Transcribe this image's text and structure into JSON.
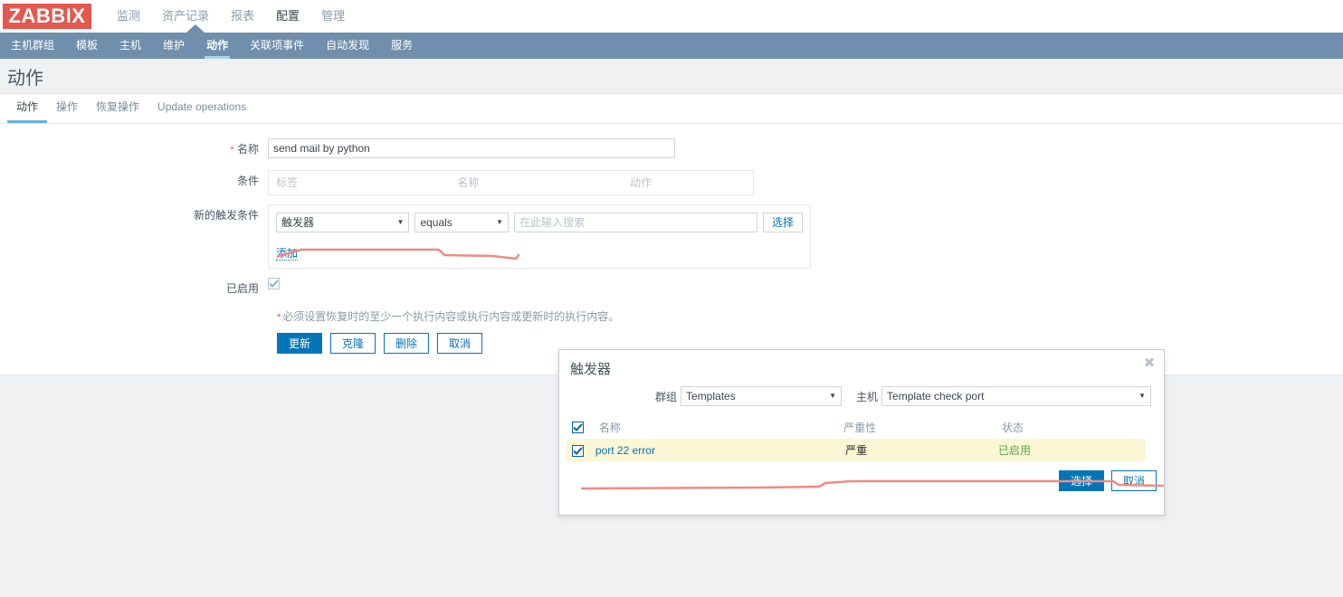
{
  "header": {
    "logo_text": "ZABBIX",
    "menu": [
      {
        "label": "监测",
        "selected": false
      },
      {
        "label": "资产记录",
        "selected": false
      },
      {
        "label": "报表",
        "selected": false
      },
      {
        "label": "配置",
        "selected": true
      },
      {
        "label": "管理",
        "selected": false
      }
    ]
  },
  "subnav": {
    "items": [
      {
        "label": "主机群组",
        "selected": false
      },
      {
        "label": "模板",
        "selected": false
      },
      {
        "label": "主机",
        "selected": false
      },
      {
        "label": "维护",
        "selected": false
      },
      {
        "label": "动作",
        "selected": true
      },
      {
        "label": "关联项事件",
        "selected": false
      },
      {
        "label": "自动发现",
        "selected": false
      },
      {
        "label": "服务",
        "selected": false
      }
    ]
  },
  "page": {
    "title": "动作"
  },
  "tabs": [
    {
      "label": "动作",
      "selected": true
    },
    {
      "label": "操作",
      "selected": false
    },
    {
      "label": "恢复操作",
      "selected": false
    },
    {
      "label": "Update operations",
      "selected": false
    }
  ],
  "form": {
    "name_label": "名称",
    "name_value": "send mail by python",
    "conditions_label": "条件",
    "conditions_headers": [
      "标签",
      "名称",
      "动作"
    ],
    "new_condition_label": "新的触发条件",
    "new_condition": {
      "type_value": "触发器",
      "operator_value": "equals",
      "search_placeholder": "在此输入搜索",
      "search_value": "",
      "select_button": "选择",
      "add_link": "添加"
    },
    "enabled_label": "已启用",
    "enabled_checked": true,
    "footnote": "必须设置恢复时的至少一个执行内容或执行内容或更新时的执行内容。",
    "buttons": [
      {
        "label": "更新",
        "primary": true
      },
      {
        "label": "克隆",
        "primary": false
      },
      {
        "label": "删除",
        "primary": false
      },
      {
        "label": "取消",
        "primary": false
      }
    ]
  },
  "modal": {
    "title": "触发器",
    "close_icon": "✖",
    "group_label": "群组",
    "group_value": "Templates",
    "host_label": "主机",
    "host_value": "Template check port",
    "table": {
      "headers": [
        "名称",
        "严重性",
        "状态"
      ],
      "header_checkbox_checked": true,
      "rows": [
        {
          "checked": true,
          "name": "port 22 error",
          "severity": "严重",
          "status": "已启用"
        }
      ]
    },
    "buttons": [
      {
        "label": "选择",
        "primary": true
      },
      {
        "label": "取消",
        "primary": false
      }
    ]
  },
  "colors": {
    "brand_red": "#e4584f",
    "subnav_blue": "#6f8fac",
    "accent_blue": "#0275b8",
    "severity_disaster": "#e55b4d",
    "row_selected": "#fbf6d4",
    "status_enabled_green": "#5ea34a",
    "annotation_red": "#f08a82"
  }
}
